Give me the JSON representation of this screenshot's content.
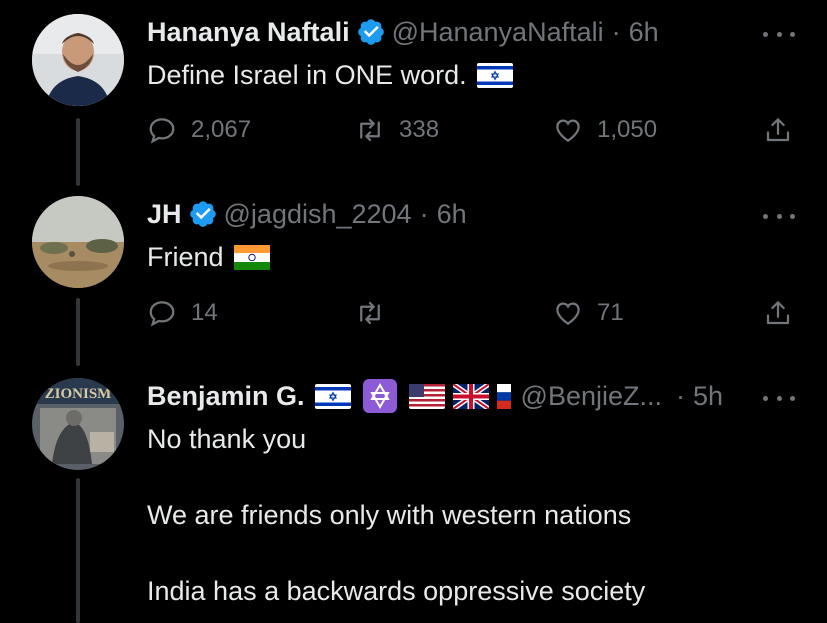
{
  "tweets": [
    {
      "name": "Hananya Naftali",
      "handle": "@HananyaNaftali",
      "separator": "·",
      "time": "6h",
      "text": "Define Israel in ONE word.",
      "flags": [
        "israel-flag"
      ],
      "reply_count": "2,067",
      "retweet_count": "338",
      "like_count": "1,050"
    },
    {
      "name": "JH",
      "handle": "@jagdish_2204",
      "separator": "·",
      "time": "6h",
      "text": "Friend",
      "flags": [
        "india-flag"
      ],
      "reply_count": "14",
      "retweet_count": "",
      "like_count": "71"
    },
    {
      "name": "Benjamin G.",
      "handle": "@BenjieZ...",
      "separator": "·",
      "time": "5h",
      "name_flags": [
        "israel-flag",
        "star-of-david-emoji",
        "usa-flag",
        "uk-flag",
        "russia-flag"
      ],
      "lines": [
        "No thank you",
        "We are friends only with western nations",
        "India has a backwards oppressive society"
      ],
      "avatar_text": "ZIONISM"
    }
  ],
  "colors": {
    "background": "#000000",
    "text": "#e7e9ea",
    "muted": "#71767b",
    "verified": "#1d9bf0",
    "thread_line": "#333639"
  },
  "icons": [
    "reply-icon",
    "retweet-icon",
    "like-icon",
    "share-icon",
    "more-icon",
    "verified-badge-icon"
  ]
}
